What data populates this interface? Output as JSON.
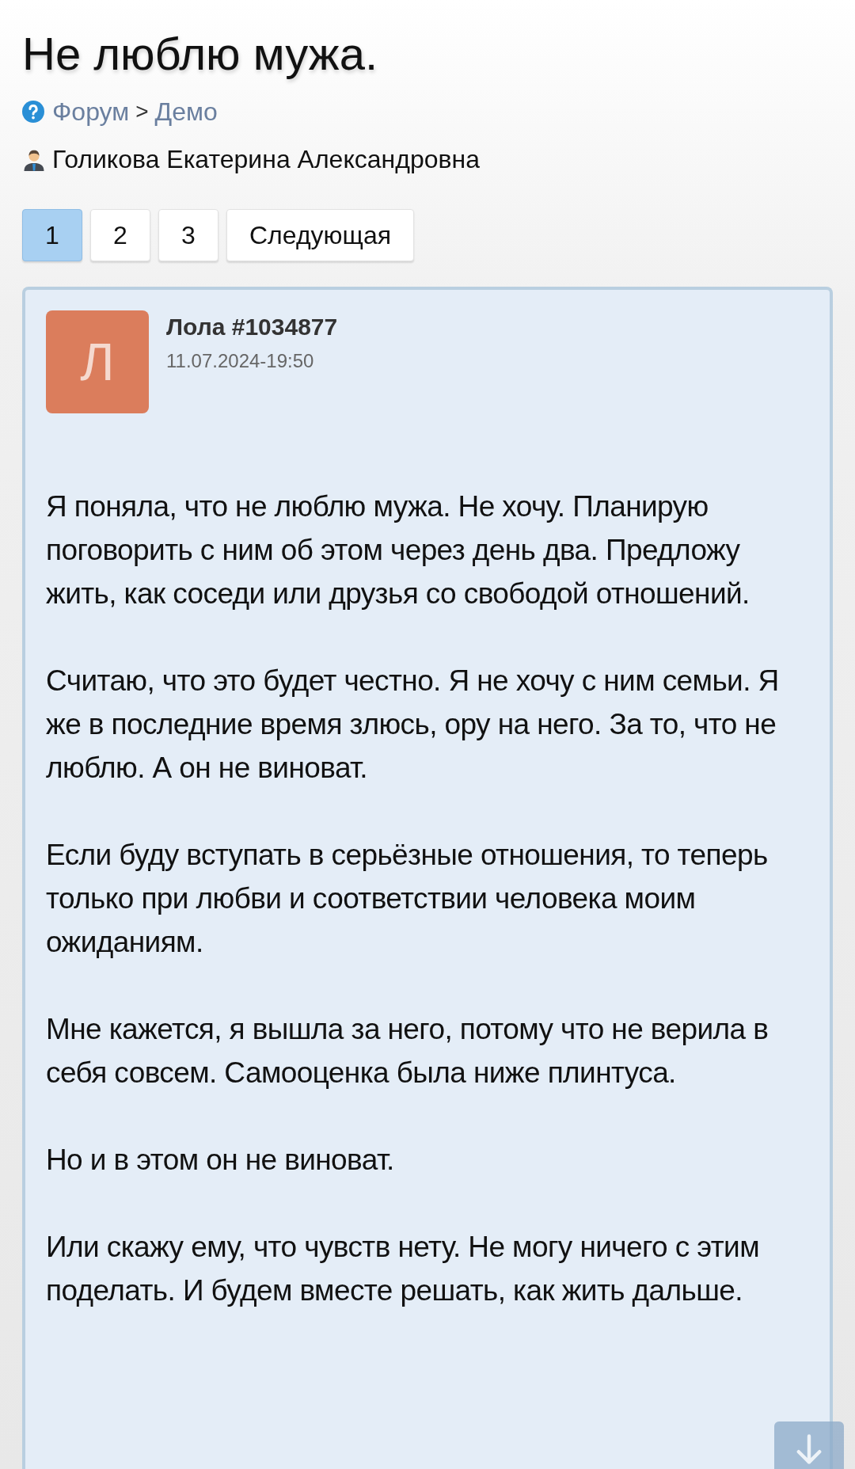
{
  "title": "Не люблю мужа.",
  "breadcrumb": {
    "links": [
      "Форум",
      "Демо"
    ],
    "separator": ">"
  },
  "author": "Голикова Екатерина Александровна",
  "pagination": [
    {
      "label": "1",
      "selected": true
    },
    {
      "label": "2",
      "selected": false
    },
    {
      "label": "3",
      "selected": false
    },
    {
      "label": "Следующая",
      "selected": false
    }
  ],
  "post": {
    "avatar_letter": "Л",
    "user": "Лола #1034877",
    "date": "11.07.2024-19:50",
    "paragraphs": [
      "Я поняла, что не люблю мужа. Не хочу. Планирую поговорить с ним об этом через день два. Предложу жить, как соседи или друзья со свободой отношений.",
      "Считаю, что это будет честно. Я не хочу с ним семьи. Я же в последние время злюсь, ору на него. За то, что не люблю. А он не виноват.",
      "Если буду вступать в серьёзные отношения, то теперь только при любви и соответствии человека моим ожиданиям.",
      "Мне кажется, я вышла за него, потому что не верила в себя совсем. Самооценка была ниже плинтуса.",
      "Но и в этом он не виноват.",
      "Или скажу ему, что чувств нету. Не могу ничего с этим поделать. И будем вместе решать, как жить дальше."
    ]
  }
}
